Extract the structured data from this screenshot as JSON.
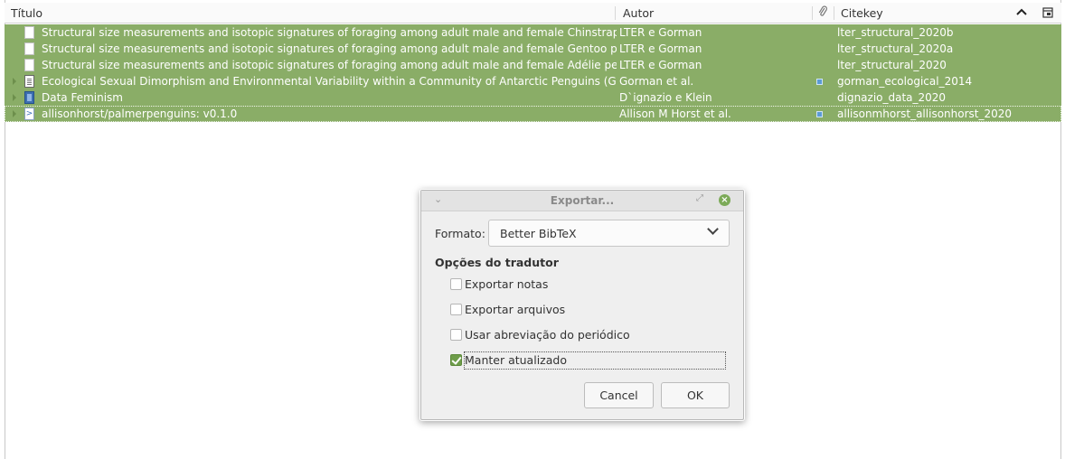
{
  "table": {
    "columns": {
      "title": "Título",
      "author": "Autor",
      "citekey": "Citekey"
    },
    "header_icons": [
      "paperclip-icon",
      "sort-ascending-icon",
      "column-picker-icon"
    ],
    "rows": [
      {
        "title": "Structural size measurements and isotopic signatures of foraging among adult male and female Chinstrap peng…",
        "author": "LTER e Gorman",
        "citekey": "lter_structural_2020b",
        "icon": "webpage-icon",
        "attachment": false,
        "expandable": false
      },
      {
        "title": "Structural size measurements and isotopic signatures of foraging among adult male and female Gentoo penguin…",
        "author": "LTER e Gorman",
        "citekey": "lter_structural_2020a",
        "icon": "webpage-icon",
        "attachment": false,
        "expandable": false
      },
      {
        "title": "Structural size measurements and isotopic signatures of foraging among adult male and female Adélie penguins…",
        "author": "LTER e Gorman",
        "citekey": "lter_structural_2020",
        "icon": "webpage-icon",
        "attachment": false,
        "expandable": false
      },
      {
        "title": "Ecological Sexual Dimorphism and Environmental Variability within a Community of Antarctic Penguins (Genus P…",
        "author": "Gorman et al.",
        "citekey": "gorman_ecological_2014",
        "icon": "journal-article-icon",
        "attachment": true,
        "expandable": true
      },
      {
        "title": "Data Feminism",
        "author": "D`ignazio e Klein",
        "citekey": "dignazio_data_2020",
        "icon": "book-icon",
        "attachment": false,
        "expandable": true
      },
      {
        "title": "allisonhorst/palmerpenguins: v0.1.0",
        "author": "Allison M Horst et al.",
        "citekey": "allisonmhorst_allisonhorst_2020",
        "icon": "software-icon",
        "attachment": true,
        "expandable": true
      }
    ]
  },
  "dialog": {
    "title": "Exportar...",
    "format_label": "Formato:",
    "format_value": "Better BibTeX",
    "options_heading": "Opções do tradutor",
    "options": [
      {
        "label": "Exportar notas",
        "checked": false
      },
      {
        "label": "Exportar arquivos",
        "checked": false
      },
      {
        "label": "Usar abreviação do periódico",
        "checked": false
      },
      {
        "label": "Manter atualizado",
        "checked": true
      }
    ],
    "cancel_label": "Cancel",
    "ok_label": "OK"
  },
  "colors": {
    "selection": "#8aad67",
    "accent_check": "#6e9d4a",
    "attachment_dot": "#5b9bd5"
  }
}
